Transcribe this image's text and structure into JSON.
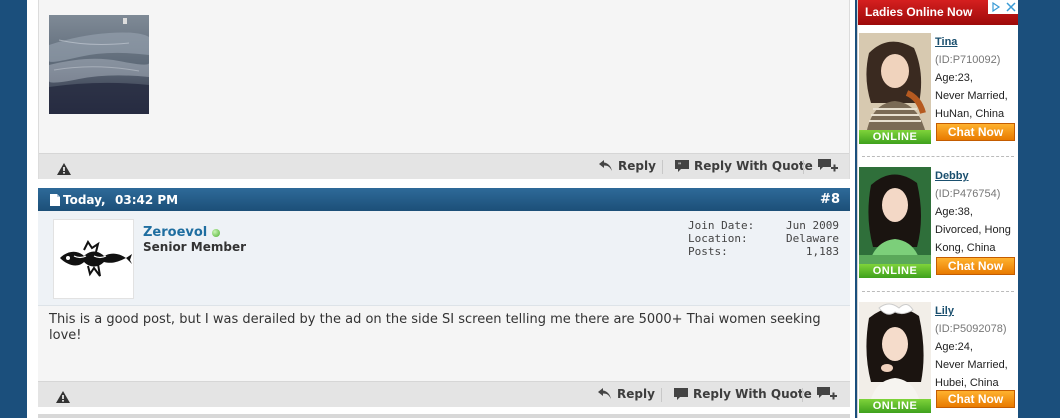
{
  "prev_post": {
    "actions": {
      "reply": "Reply",
      "reply_with_quote": "Reply With Quote"
    }
  },
  "post8": {
    "date": "Today,",
    "time": "03:42 PM",
    "number": "#8",
    "user": {
      "name": "Zeroevol",
      "title": "Senior Member",
      "stats": [
        {
          "label": "Join Date:",
          "value": "Jun 2009"
        },
        {
          "label": "Location:",
          "value": "Delaware"
        },
        {
          "label": "Posts:",
          "value": "1,183"
        }
      ]
    },
    "message": "This is a good post, but I was derailed by the ad on the side SI screen telling me there are 5000+ Thai women seeking love!",
    "actions": {
      "reply": "Reply",
      "reply_with_quote": "Reply With Quote"
    }
  },
  "ad": {
    "header": "Ladies Online Now",
    "cards": [
      {
        "name": "Tina",
        "id": "(ID:P710092)",
        "age": "Age:23,",
        "status": "Never Married,",
        "loc": "HuNan, China",
        "online": "ONLINE",
        "chat": "Chat Now"
      },
      {
        "name": "Debby",
        "id": "(ID:P476754)",
        "age": "Age:38,",
        "status": "Divorced, Hong",
        "loc": "Kong, China",
        "online": "ONLINE",
        "chat": "Chat Now"
      },
      {
        "name": "Lily",
        "id": "(ID:P5092078)",
        "age": "Age:24,",
        "status": "Never Married,",
        "loc": "Hubei, China",
        "online": "ONLINE",
        "chat": "Chat Now"
      }
    ]
  },
  "colors": {
    "background": "#1b4f7c",
    "post_header": "#1c4f78",
    "username": "#1f6ea0",
    "ad_red": "#c41414",
    "chat_orange": "#f29100",
    "online_green": "#4cae2e"
  }
}
